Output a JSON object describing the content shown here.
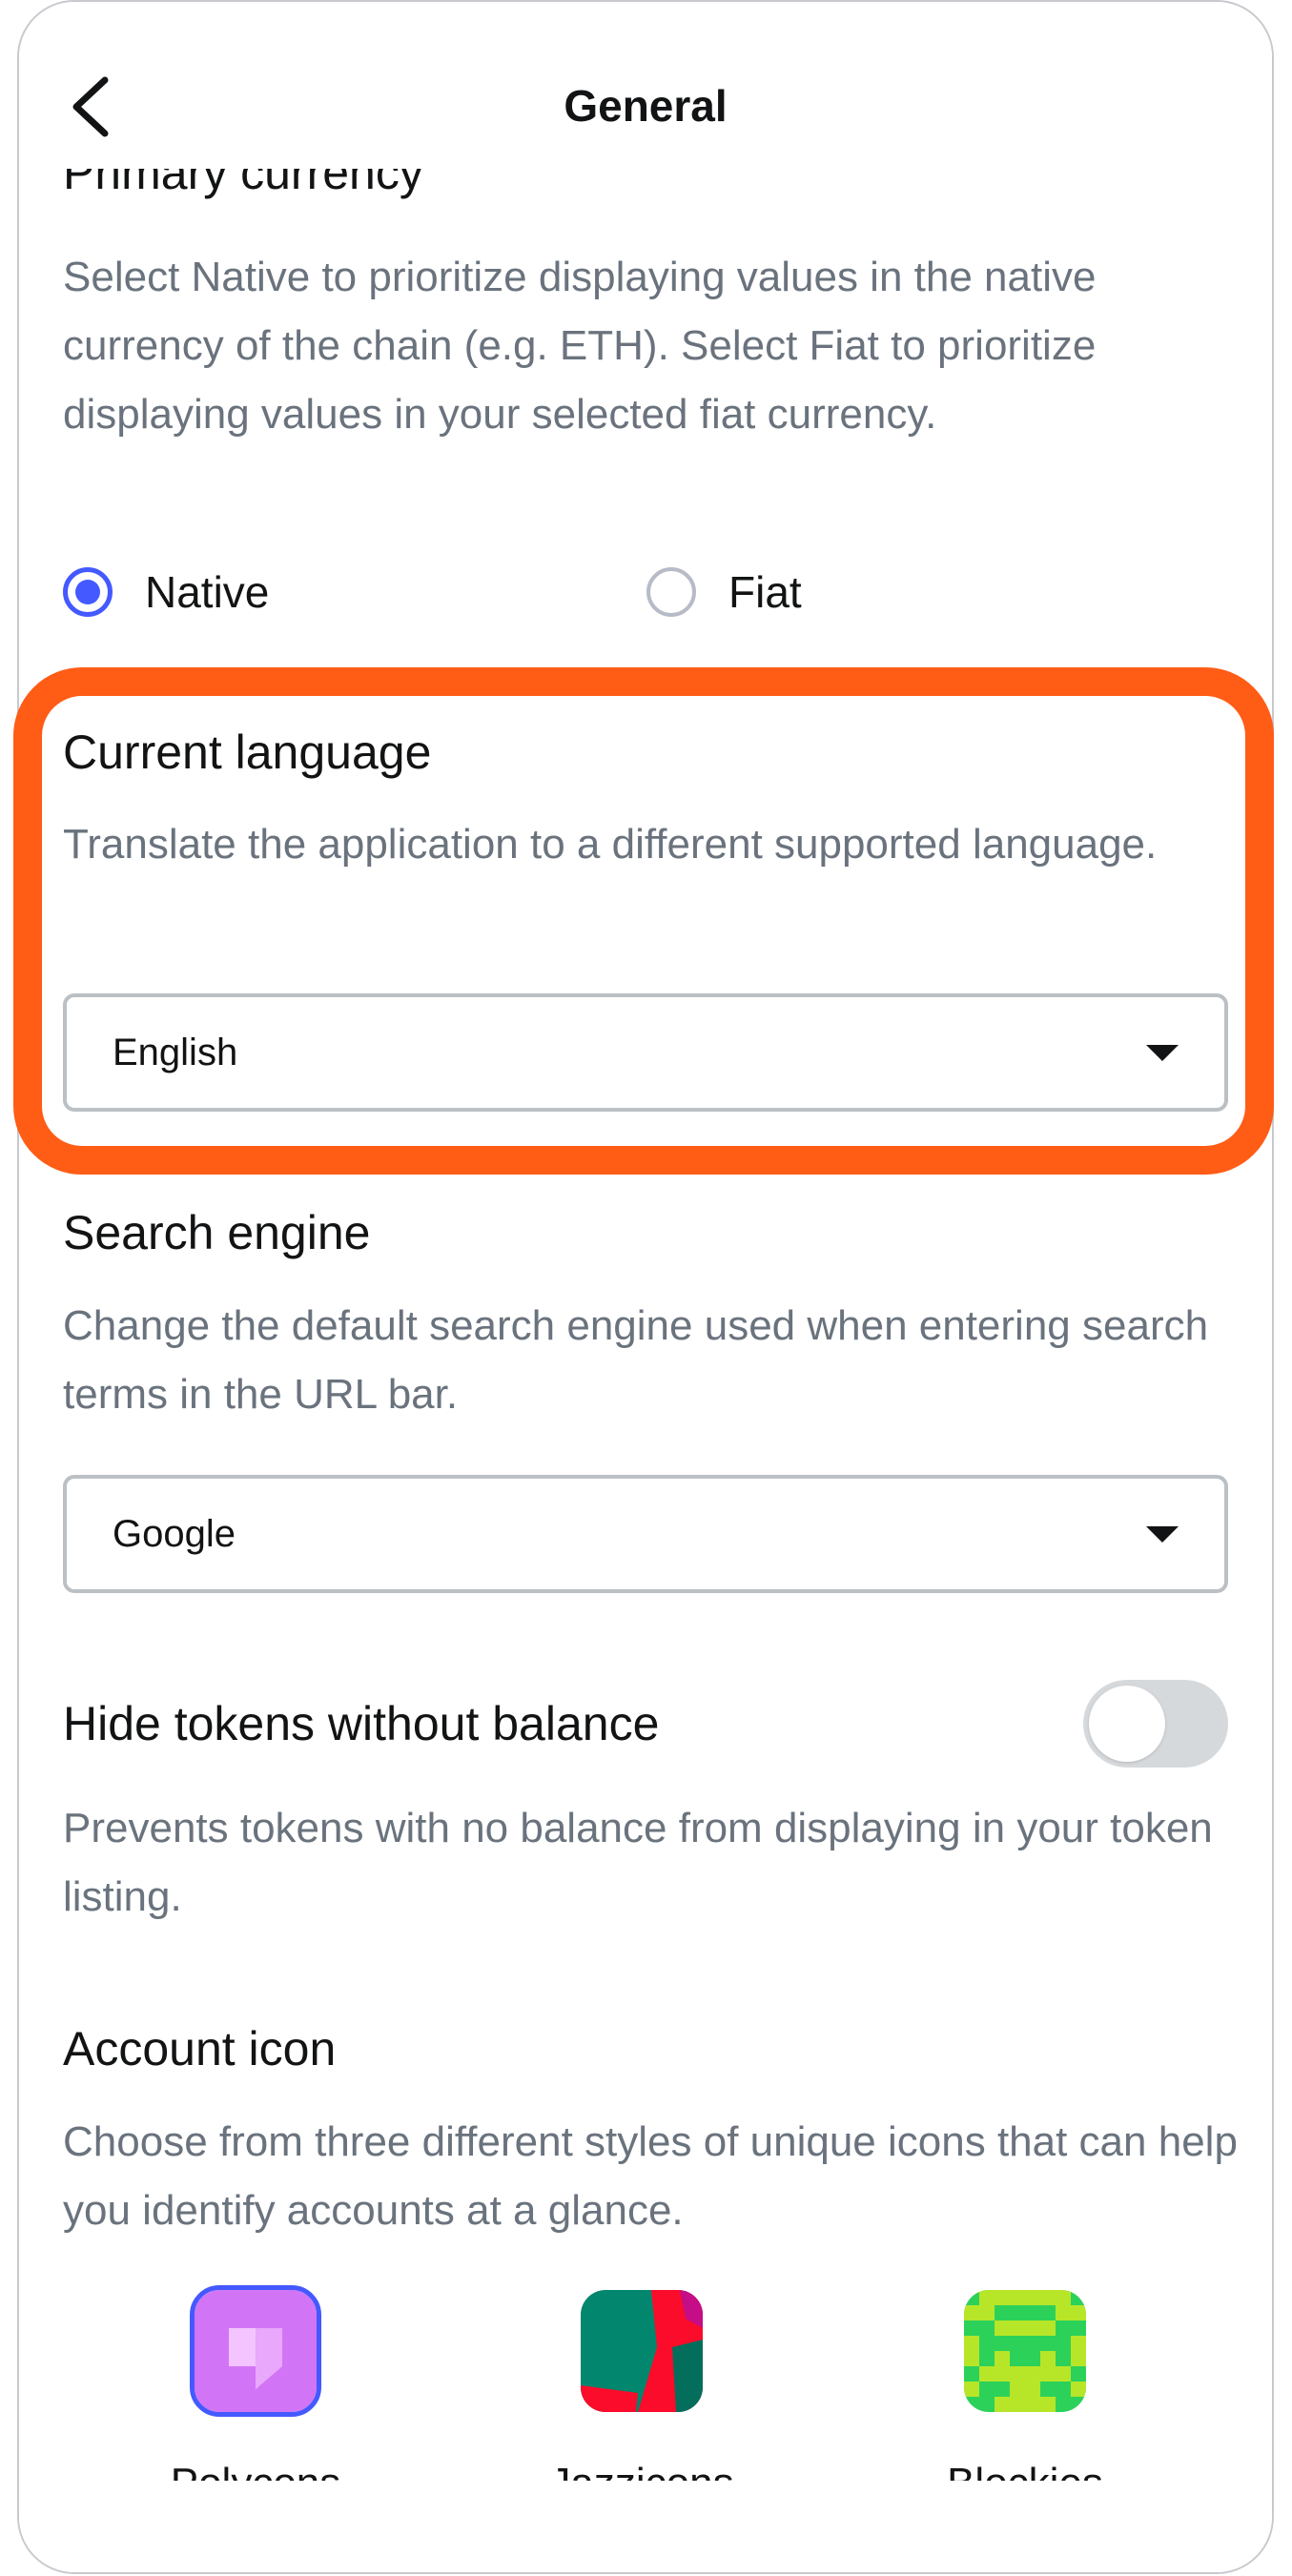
{
  "header": {
    "title": "General",
    "back_icon": "chevron-left-icon"
  },
  "primary_currency": {
    "title": "Primary currency",
    "description": "Select Native to prioritize displaying values in the native currency of the chain (e.g. ETH). Select Fiat to prioritize displaying values in your selected fiat currency.",
    "options": [
      {
        "label": "Native",
        "selected": true
      },
      {
        "label": "Fiat",
        "selected": false
      }
    ]
  },
  "current_language": {
    "title": "Current language",
    "description": "Translate the application to a different supported language.",
    "selected_value": "English",
    "highlighted": true
  },
  "search_engine": {
    "title": "Search engine",
    "description": "Change the default search engine used when entering search terms in the URL bar.",
    "selected_value": "Google"
  },
  "hide_tokens": {
    "title": "Hide tokens without balance",
    "description": "Prevents tokens with no balance from displaying in your token listing.",
    "enabled": false
  },
  "account_icon": {
    "title": "Account icon",
    "description": "Choose from three different styles of unique icons that can help you identify accounts at a glance.",
    "options": [
      {
        "label": "Polycons",
        "selected": true
      },
      {
        "label": "Jazzicons",
        "selected": false
      },
      {
        "label": "Blockies",
        "selected": false
      }
    ]
  },
  "colors": {
    "accent": "#4459ff",
    "highlight": "#ff5c16",
    "text_primary": "#121314",
    "text_muted": "#6a737d",
    "border": "#bbc0c5"
  }
}
